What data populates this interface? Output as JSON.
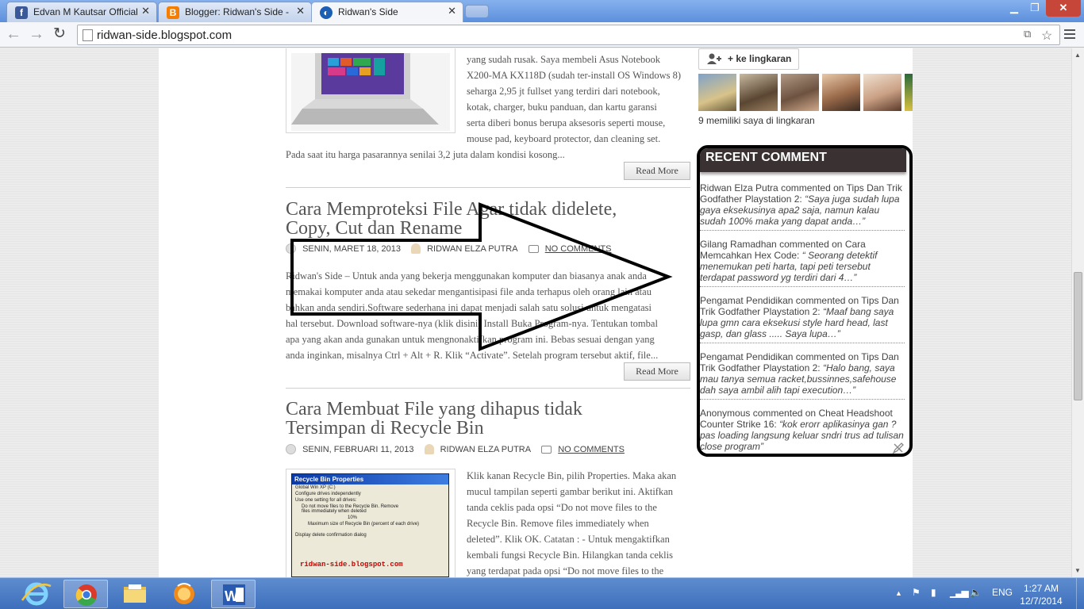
{
  "browser": {
    "tabs": [
      {
        "title": "Edvan M Kautsar Official",
        "favicon": "facebook-icon",
        "active": false
      },
      {
        "title": "Blogger: Ridwan's Side - B",
        "favicon": "blogger-icon",
        "active": false
      },
      {
        "title": "Ridwan's Side",
        "favicon": "chrome-page-icon",
        "active": true
      }
    ],
    "url": "ridwan-side.blogspot.com"
  },
  "posts": {
    "first_excerpt": [
      "yang sudah rusak. Saya membeli Asus Notebook",
      "X200-MA KX118D (sudah ter-install OS Windows 8)",
      "seharga 2,95 jt fullset yang terdiri dari notebook,",
      "kotak, charger, buku panduan, dan kartu garansi",
      "serta diberi bonus berupa aksesoris seperti mouse,",
      "mouse pad, keyboard protector, dan cleaning set.",
      "Pada saat itu harga pasarannya senilai 3,2 juta dalam kondisi kosong..."
    ],
    "read_more": "Read More",
    "second": {
      "title_line1": "Cara Memproteksi File Agar tidak didelete,",
      "title_line2": "Copy, Cut dan Rename",
      "date": "SENIN, MARET 18, 2013",
      "author": "RIDWAN ELZA PUTRA",
      "comments": "NO COMMENTS",
      "body": [
        "Ridwan's Side – Untuk anda yang bekerja menggunakan komputer dan biasanya anak anda",
        "memakai komputer anda atau sekedar mengantisipasi file anda terhapus oleh orang lain atau",
        "bahkan anda sendiri.Software sederhana ini dapat menjadi salah satu solusi untuk mengatasi",
        "hal tersebut. Download software-nya (klik disini) Install Buka Program-nya. Tentukan tombal",
        "apa yang akan anda gunakan untuk mengnonaktifkan program ini. Bebas sesuai dengan yang",
        "anda inginkan, misalnya Ctrl + Alt + R. Klik “Activate”. Setelah program tersebut aktif, file..."
      ]
    },
    "third": {
      "title_line1": "Cara Membuat File yang dihapus tidak",
      "title_line2": "Tersimpan di Recycle Bin",
      "date": "SENIN, FEBRUARI 11, 2013",
      "author": "RIDWAN ELZA PUTRA",
      "comments": "NO COMMENTS",
      "body": [
        "Klik kanan Recycle Bin, pilih Properties. Maka akan",
        "mucul tampilan seperti gambar berikut ini. Aktifkan",
        "tanda ceklis pada opsi “Do not move files to the",
        "Recycle Bin. Remove files immediately when",
        "deleted”. Klik OK. Catatan : -        Untuk mengaktifkan",
        "kembali fungsi Recycle Bin. Hilangkan tanda ceklis",
        "yang terdapat pada opsi  “Do not move files to the"
      ],
      "image": {
        "title": "Recycle Bin Properties",
        "tabs": "Global   Win XP (C:)",
        "opt1": "Configure drives independently",
        "opt2": "Use one setting for all drives:",
        "opt3": "Do not move files to the Recycle Bin. Remove files immediately when deleted",
        "percent": "10%",
        "max_label": "Maximum size of Recycle Bin (percent of each drive)",
        "opt4": "Display delete confirmation dialog",
        "watermark": "ridwan-side.blogspot.com"
      }
    }
  },
  "sidebar": {
    "follow_label": "+ ke lingkaran",
    "circles_count": "9 memiliki saya di lingkaran",
    "recent_comment": {
      "heading": "RECENT COMMENT",
      "items": [
        {
          "author": "Ridwan Elza Putra",
          "verb": "commented on",
          "post": "Tips Dan Trik Godfather Playstation 2:",
          "text": "“Saya juga sudah lupa gaya eksekusinya apa2 saja, namun kalau sudah 100% maka yang dapat anda…”"
        },
        {
          "author": "Gilang Ramadhan",
          "verb": "commented on",
          "post": "Cara Memcahkan Hex Code:",
          "text": "“ Seorang detektif menemukan peti harta, tapi peti tersebut terdapat password yg terdiri dari 4…”"
        },
        {
          "author": "Pengamat Pendidikan",
          "verb": "commented on",
          "post": "Tips Dan Trik Godfather Playstation 2:",
          "text": "“Maaf bang saya lupa gmn cara eksekusi style hard head, last gasp, dan glass ..... Saya lupa…”"
        },
        {
          "author": "Pengamat Pendidikan",
          "verb": "commented on",
          "post": "Tips Dan Trik Godfather Playstation 2:",
          "text": "“Halo bang, saya mau tanya semua racket,bussinnes,safehouse dah saya ambil alih tapi execution…”"
        },
        {
          "author": "Anonymous",
          "verb": "commented on",
          "post": "Cheat Headshoot Counter Strike 16:",
          "text": "“kok erorr aplikasinya gan ? pas loading langsung keluar sndri trus ad tulisan close program”"
        }
      ]
    }
  },
  "taskbar": {
    "language": "ENG",
    "time": "1:27 AM",
    "date": "12/7/2014"
  }
}
